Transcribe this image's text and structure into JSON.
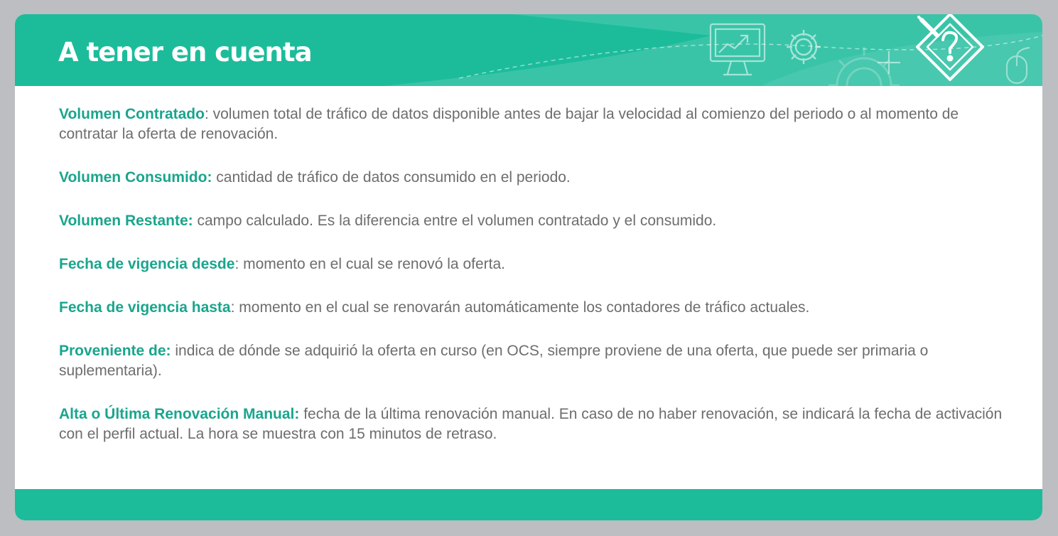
{
  "header": {
    "title": "A tener en cuenta",
    "icons": [
      "computer-chart-icon",
      "gear-icon",
      "document-question-icon",
      "mouse-icon"
    ]
  },
  "items": [
    {
      "term": "Volumen Contratado",
      "text": ": volumen total de tráfico de datos disponible antes de bajar la velocidad al comienzo del periodo o al momento de contratar la oferta de renovación."
    },
    {
      "term": "Volumen Consumido:",
      "text": " cantidad de tráfico de datos consumido en el periodo."
    },
    {
      "term": "Volumen Restante:",
      "text": " campo calculado. Es la diferencia entre el volumen contratado y el consumido."
    },
    {
      "term": "Fecha de vigencia desde",
      "text": ": momento en el cual se renovó la oferta."
    },
    {
      "term": "Fecha de vigencia hasta",
      "text": ": momento en el cual se renovarán automáticamente los contadores de tráfico actuales."
    },
    {
      "term": "Proveniente de:",
      "text": " indica de dónde se adquirió la oferta en curso (en OCS, siempre proviene de una oferta, que puede ser primaria o suplementaria)."
    },
    {
      "term": "Alta o Última Renovación Manual:",
      "text": " fecha de la última renovación manual. En caso de no haber renovación, se indicará la fecha de activación con el perfil actual. La hora se muestra con 15 minutos de retraso."
    }
  ],
  "colors": {
    "accent": "#1cbc9b",
    "term": "#1aa58d",
    "body_text": "#6d6d6d",
    "background": "#bcbec2"
  }
}
